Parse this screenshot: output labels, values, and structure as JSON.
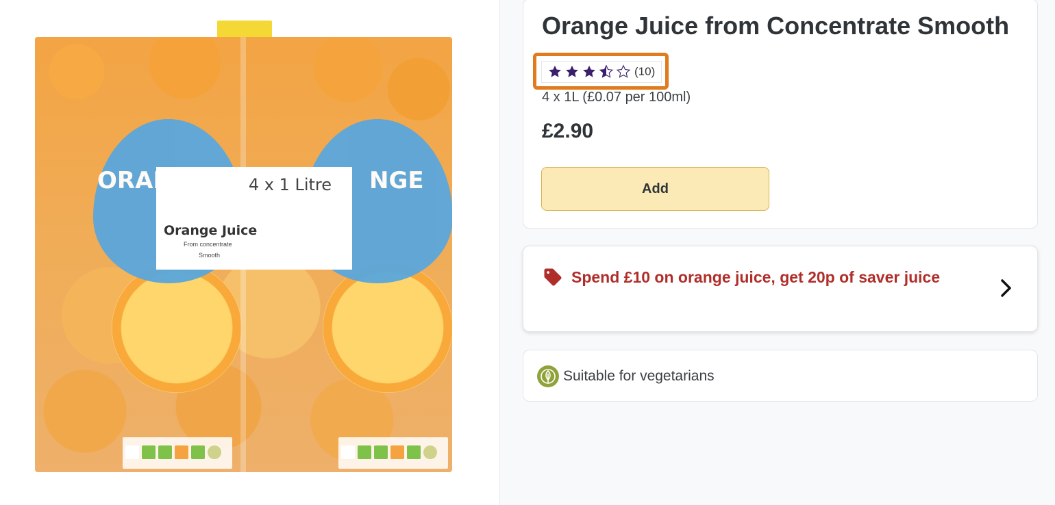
{
  "product_image": {
    "alt_icon": "orange-juice-pack-image",
    "pack_size_label": "4 x 1 Litre",
    "pack_name": "Orange Juice",
    "pack_sub1": "From concentrate",
    "pack_sub2": "Smooth",
    "drop_left_text": "ORAN",
    "drop_right_text": "NGE"
  },
  "product": {
    "title": "Orange Juice from Concentrate Smooth",
    "rating": {
      "value": 3.5,
      "max": 5,
      "count_label": "(10)"
    },
    "pack_size": "4 x 1L (£0.07 per 100ml)",
    "price": "£2.90",
    "add_label": "Add"
  },
  "offer": {
    "icon": "tag-icon",
    "text": "Spend £10 on orange juice, get 20p of saver juice"
  },
  "dietary": {
    "icon": "leaf-icon",
    "text": "Suitable for vegetarians"
  },
  "colors": {
    "star": "#3b1f6b",
    "highlight": "#e07b1e",
    "offer_text": "#b02e2a",
    "add_button": "#fbeab5",
    "veg_icon": "#8fa33a"
  }
}
